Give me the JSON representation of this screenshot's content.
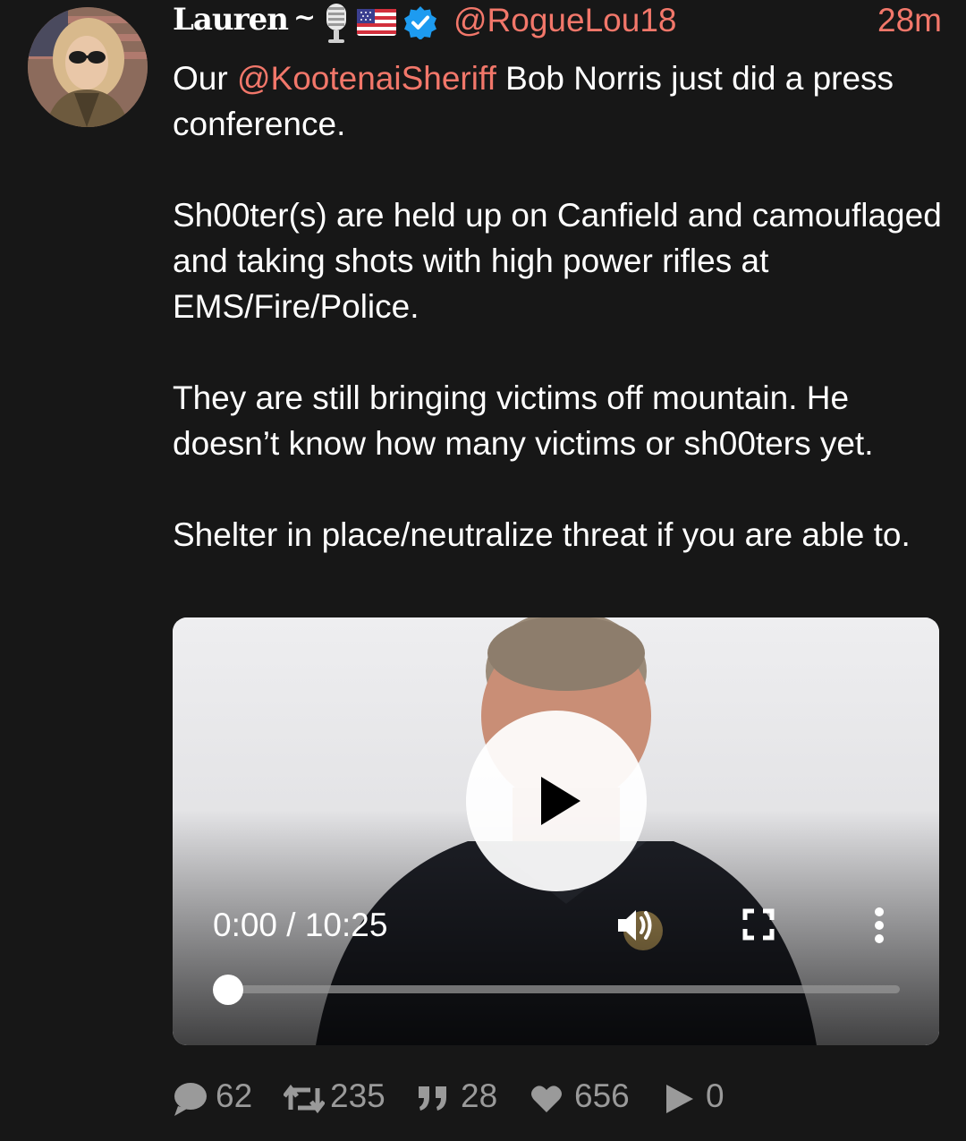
{
  "author": {
    "display_name": "Lauren",
    "separator": "~",
    "handle": "@RogueLou18",
    "timestamp": "28m",
    "icons": [
      "microphone-emoji",
      "us-flag-emoji",
      "verified-badge"
    ]
  },
  "post": {
    "paragraphs": [
      {
        "prefix": "Our ",
        "mention": "@KootenaiSheriff",
        "suffix": " Bob Norris just did a press conference."
      },
      {
        "text": "Sh00ter(s) are held up on Canfield and camouflaged and taking shots with high power rifles at EMS/Fire/Police."
      },
      {
        "text": "They are still bringing victims off mountain. He doesn’t know how many victims or sh00ters yet."
      },
      {
        "text": "Shelter in place/neutralize threat if you are able to."
      }
    ]
  },
  "video": {
    "time_readout": "0:00 / 10:25",
    "progress": 0,
    "controls": [
      "play-icon",
      "volume-icon",
      "fullscreen-icon",
      "more-options-icon"
    ]
  },
  "stats": {
    "replies": "62",
    "reposts": "235",
    "quotes": "28",
    "likes": "656",
    "views": "0"
  },
  "colors": {
    "background": "#171717",
    "accent": "#f2776a",
    "verified": "#1d9bf0",
    "muted": "#9a9a9a"
  }
}
